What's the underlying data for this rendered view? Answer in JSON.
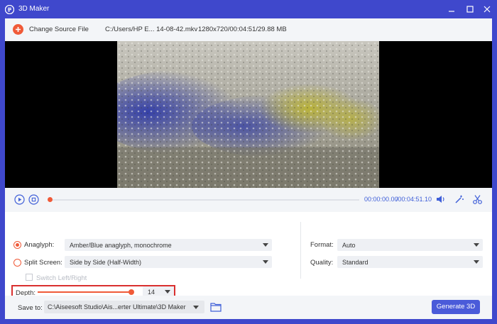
{
  "window": {
    "title": "3D Maker"
  },
  "source": {
    "change_label": "Change Source File",
    "file_path": "C:/Users/HP E... 14-08-42.mkv",
    "file_info": "1280x720/00:04:51/29.88 MB"
  },
  "playback": {
    "current_time": "00:00:00.00",
    "total_time": "/00:04:51.10",
    "progress": 0.0
  },
  "settings": {
    "anaglyph": {
      "label": "Anaglyph:",
      "selected": true,
      "value": "Amber/Blue anaglyph, monochrome"
    },
    "split_screen": {
      "label": "Split Screen:",
      "selected": false,
      "value": "Side by Side (Half-Width)"
    },
    "switch_lr": {
      "label": "Switch Left/Right",
      "checked": false,
      "enabled": false
    },
    "depth": {
      "label": "Depth:",
      "value": "14",
      "level_fraction": 0.85
    },
    "format": {
      "label": "Format:",
      "value": "Auto"
    },
    "quality": {
      "label": "Quality:",
      "value": "Standard"
    }
  },
  "footer": {
    "save_label": "Save to:",
    "save_path": "C:\\Aiseesoft Studio\\Ais...erter Ultimate\\3D Maker",
    "generate_label": "Generate 3D"
  },
  "colors": {
    "title_bar": "#3f48cc",
    "accent_orange": "#f05a38",
    "accent_blue": "#4a5bd9",
    "highlight_red": "#d9302f"
  },
  "icons": {
    "app": "app-logo-icon",
    "add": "plus-circle-icon",
    "play": "play-icon",
    "stop": "stop-icon",
    "volume": "volume-icon",
    "effects": "magic-wand-icon",
    "trim": "scissors-icon",
    "folder": "folder-icon",
    "minimize": "minimize-icon",
    "maximize": "maximize-icon",
    "close": "close-icon"
  }
}
